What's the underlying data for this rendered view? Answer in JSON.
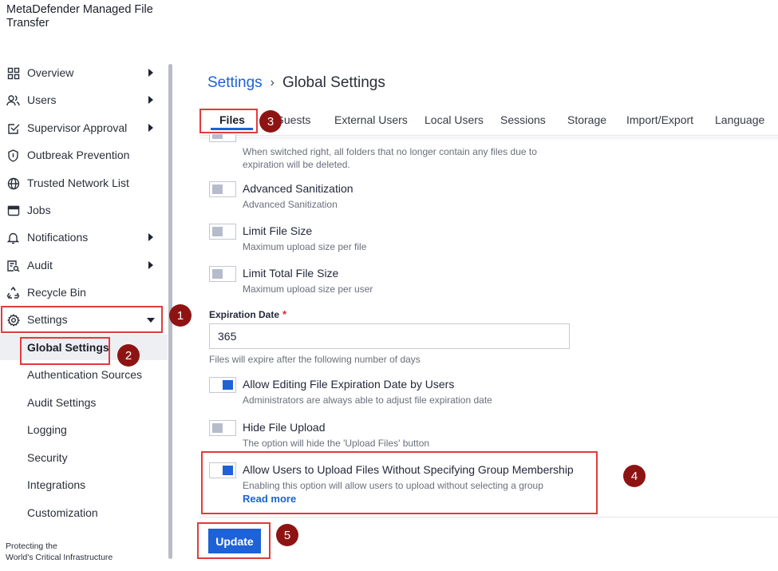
{
  "app": {
    "title": "MetaDefender Managed File Transfer"
  },
  "sidebar": {
    "items": [
      {
        "label": "Overview",
        "icon": "grid-icon",
        "expandable": true
      },
      {
        "label": "Users",
        "icon": "users-icon",
        "expandable": true
      },
      {
        "label": "Supervisor Approval",
        "icon": "approval-icon",
        "expandable": true
      },
      {
        "label": "Outbreak Prevention",
        "icon": "shield-icon",
        "expandable": false
      },
      {
        "label": "Trusted Network List",
        "icon": "globe-icon",
        "expandable": false
      },
      {
        "label": "Jobs",
        "icon": "window-icon",
        "expandable": false
      },
      {
        "label": "Notifications",
        "icon": "bell-icon",
        "expandable": true
      },
      {
        "label": "Audit",
        "icon": "audit-icon",
        "expandable": true
      },
      {
        "label": "Recycle Bin",
        "icon": "recycle-icon",
        "expandable": false
      },
      {
        "label": "Settings",
        "icon": "gear-icon",
        "expandable": true,
        "expanded": true
      }
    ],
    "settings_sub": [
      {
        "label": "Global Settings",
        "active": true
      },
      {
        "label": "Authentication Sources"
      },
      {
        "label": "Audit Settings"
      },
      {
        "label": "Logging"
      },
      {
        "label": "Security"
      },
      {
        "label": "Integrations"
      },
      {
        "label": "Customization"
      }
    ],
    "footer": [
      "Protecting the",
      "World's Critical Infrastructure"
    ]
  },
  "breadcrumb": {
    "parent": "Settings",
    "separator": "›",
    "current": "Global Settings"
  },
  "tabs": [
    "Files",
    "Guests",
    "External Users",
    "Local Users",
    "Sessions",
    "Storage",
    "Import/Export",
    "Language"
  ],
  "settings": {
    "partial_desc": "When switched right, all folders that no longer contain any files due to expiration will be deleted.",
    "advanced_sanitization": {
      "title": "Advanced Sanitization",
      "desc": "Advanced Sanitization",
      "on": false
    },
    "limit_file_size": {
      "title": "Limit File Size",
      "desc": "Maximum upload size per file",
      "on": false
    },
    "limit_total_file_size": {
      "title": "Limit Total File Size",
      "desc": "Maximum upload size per user",
      "on": false
    },
    "expiration": {
      "label": "Expiration Date",
      "required_mark": "*",
      "value": "365",
      "help": "Files will expire after the following number of days"
    },
    "allow_editing_expiration": {
      "title": "Allow Editing File Expiration Date by Users",
      "desc": "Administrators are always able to adjust file expiration date",
      "on": true
    },
    "hide_file_upload": {
      "title": "Hide File Upload",
      "desc": "The option will hide the 'Upload Files' button",
      "on": false
    },
    "allow_upload_without_group": {
      "title": "Allow Users to Upload Files Without Specifying Group Membership",
      "desc": "Enabling this option will allow users to upload without selecting a group",
      "on": true
    },
    "read_more": "Read more"
  },
  "actions": {
    "update_label": "Update"
  },
  "annotations": [
    "1",
    "2",
    "3",
    "4",
    "5"
  ],
  "colors": {
    "accent": "#1d62d6",
    "annotation_border": "#e23b3b",
    "annotation_badge": "#8e1414"
  }
}
